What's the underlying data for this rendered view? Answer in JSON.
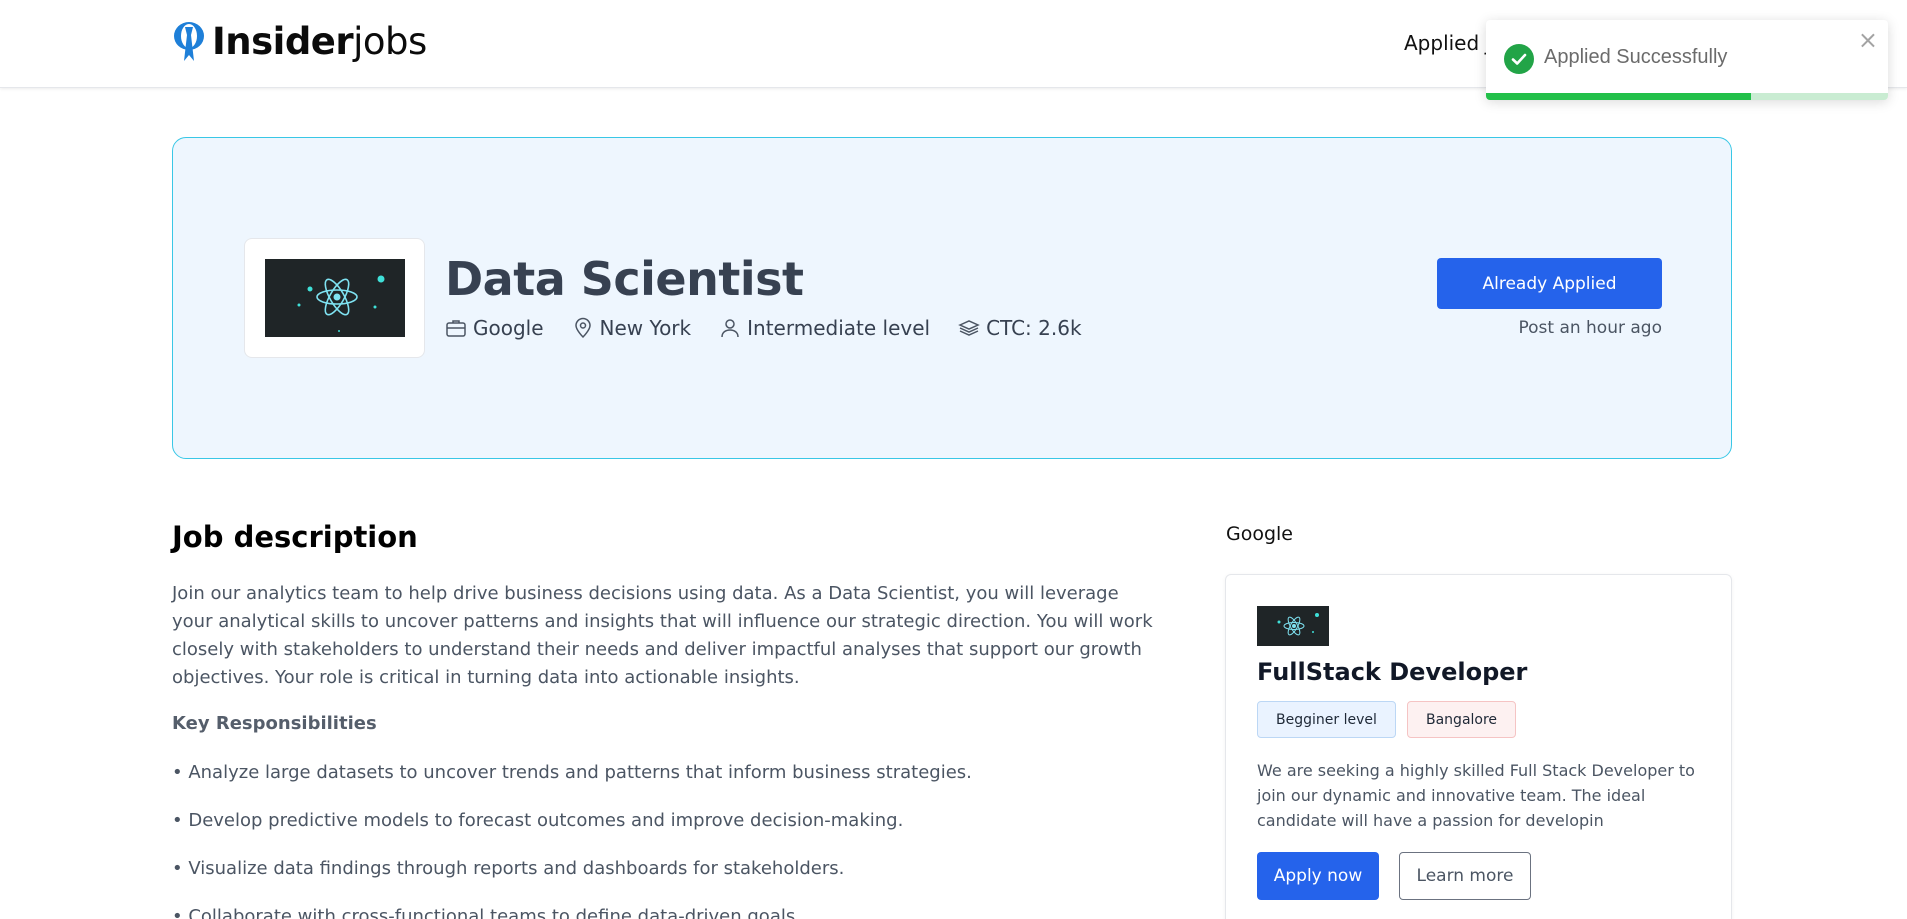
{
  "header": {
    "logo_bold": "Insider",
    "logo_light": "jobs",
    "nav_applied": "Applied J"
  },
  "toast": {
    "message": "Applied Successfully",
    "close_glyph": "×",
    "progress": 0.66,
    "icon": "check-circle-icon"
  },
  "job": {
    "title": "Data Scientist",
    "company": "Google",
    "location": "New York",
    "level": "Intermediate level",
    "ctc": "CTC: 2.6k",
    "apply_status_label": "Already Applied",
    "posted": "Post an hour ago"
  },
  "description": {
    "heading": "Job description",
    "intro": "Join our analytics team to help drive business decisions using data. As a Data Scientist, you will leverage your analytical skills to uncover patterns and insights that will influence our strategic direction. You will work closely with stakeholders to understand their needs and deliver impactful analyses that support our growth objectives. Your role is critical in turning data into actionable insights.",
    "responsibilities_heading": "Key Responsibilities",
    "bullets": [
      "• Analyze large datasets to uncover trends and patterns that inform business strategies.",
      "• Develop predictive models to forecast outcomes and improve decision-making.",
      "• Visualize data findings through reports and dashboards for stakeholders.",
      "• Collaborate with cross-functional teams to define data-driven goals."
    ]
  },
  "sidebar": {
    "company": "Google",
    "card": {
      "title": "FullStack Developer",
      "level_tag": "Begginer level",
      "location_tag": "Bangalore",
      "description": "We are seeking a highly skilled Full Stack Developer to join our dynamic and innovative team. The ideal candidate will have a passion for developin",
      "apply_label": "Apply now",
      "learn_label": "Learn more"
    }
  },
  "colors": {
    "primary": "#2563eb",
    "hero_bg": "#eef6fe",
    "hero_border": "#39c7e6",
    "success": "#22a447"
  }
}
